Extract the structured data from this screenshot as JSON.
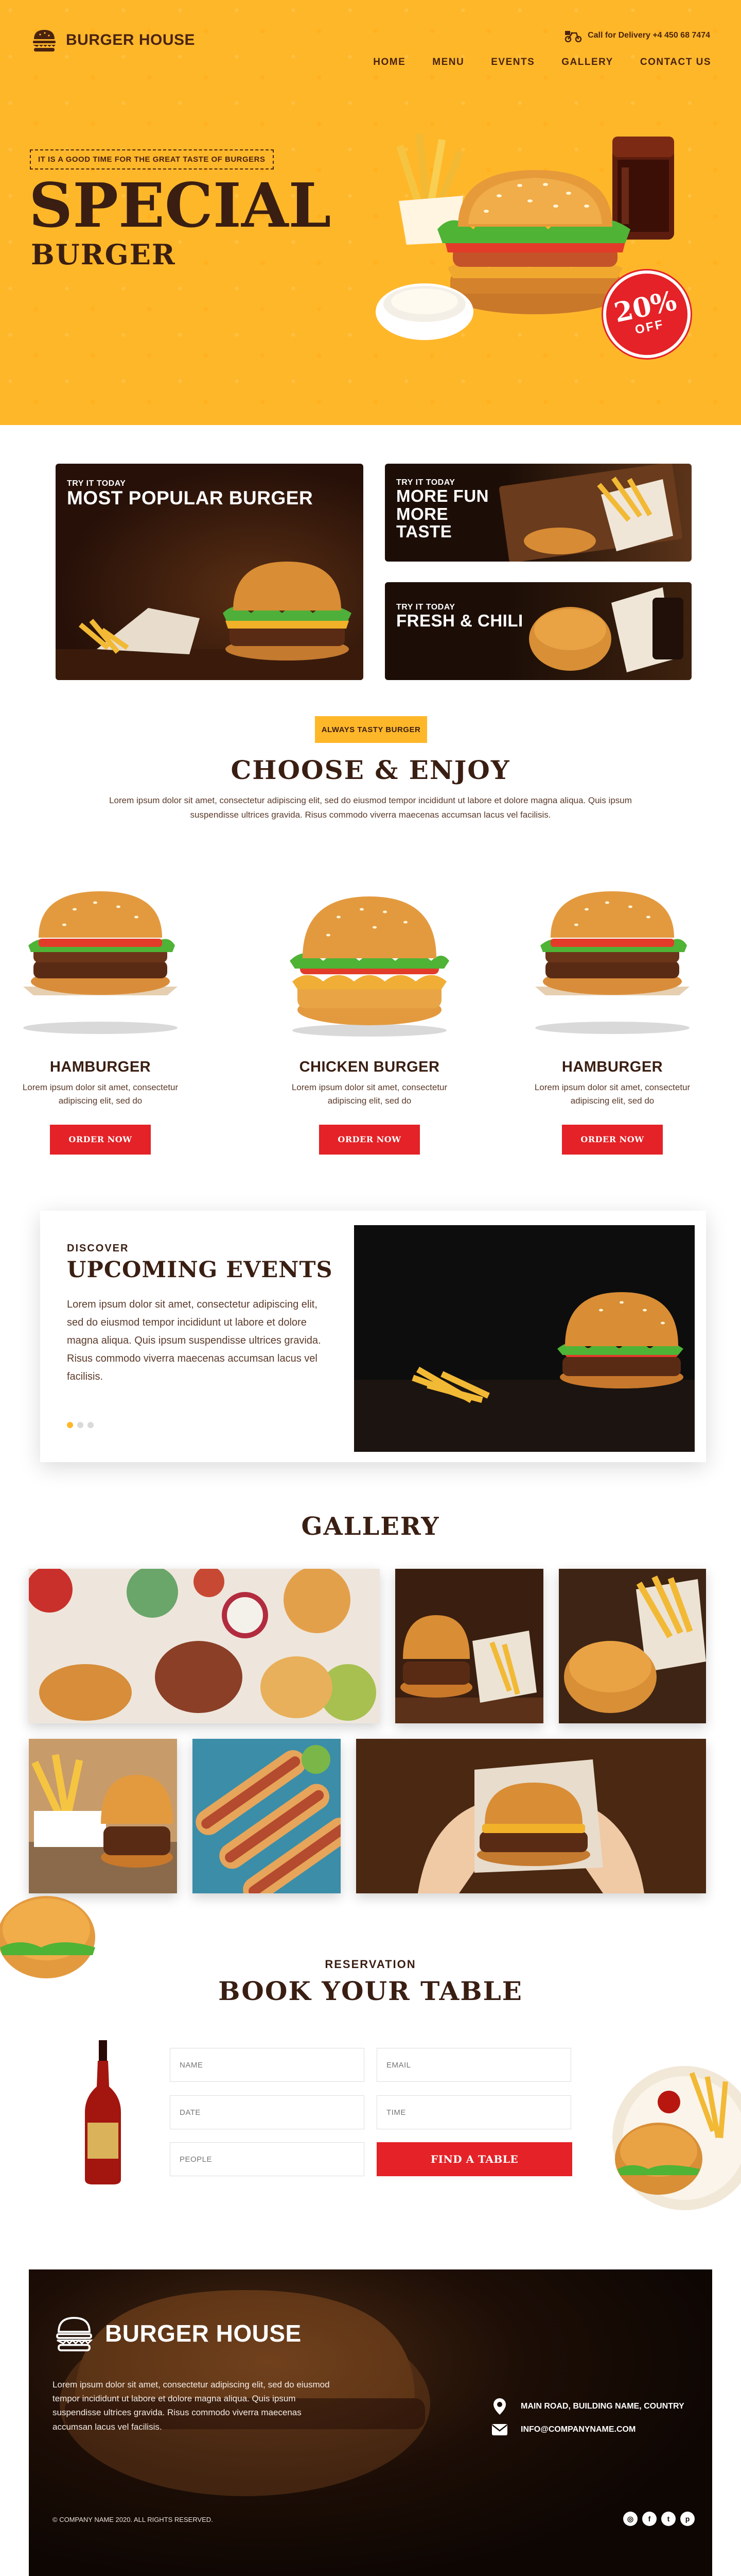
{
  "brand": {
    "name": "BURGER HOUSE"
  },
  "header": {
    "delivery": "Call for Delivery +4 450 68 7474",
    "nav": [
      "HOME",
      "MENU",
      "EVENTS",
      "GALLERY",
      "CONTACT US"
    ]
  },
  "hero": {
    "tagline": "IT IS A GOOD TIME FOR THE GREAT TASTE OF BURGERS",
    "title": "SPECIAL",
    "subtitle": "BURGER",
    "discount_pct": "20%",
    "discount_off": "OFF"
  },
  "promos": [
    {
      "small": "TRY IT TODAY",
      "big": "MOST POPULAR BURGER"
    },
    {
      "small": "TRY IT TODAY",
      "big": "MORE FUN MORE TASTE"
    },
    {
      "small": "TRY IT TODAY",
      "big": "FRESH & CHILI"
    }
  ],
  "choose": {
    "badge": "ALWAYS TASTY BURGER",
    "title": "CHOOSE & ENJOY",
    "desc": "Lorem ipsum dolor sit amet, consectetur adipiscing elit, sed do eiusmod tempor incididunt ut labore et dolore magna aliqua. Quis ipsum suspendisse ultrices gravida. Risus commodo viverra maecenas accumsan lacus vel facilisis."
  },
  "products": [
    {
      "name": "HAMBURGER",
      "desc": "Lorem ipsum dolor sit amet, consectetur adipiscing elit, sed do",
      "button": "ORDER NOW"
    },
    {
      "name": "CHICKEN BURGER",
      "desc": "Lorem ipsum dolor sit amet, consectetur adipiscing elit, sed do",
      "button": "ORDER NOW"
    },
    {
      "name": "HAMBURGER",
      "desc": "Lorem ipsum dolor sit amet, consectetur adipiscing elit, sed do",
      "button": "ORDER NOW"
    }
  ],
  "events": {
    "kicker": "DISCOVER",
    "title": "UPCOMING EVENTS",
    "text": "Lorem ipsum dolor sit amet, consectetur adipiscing elit, sed do eiusmod tempor incididunt ut labore et dolore magna aliqua. Quis ipsum suspendisse ultrices gravida. Risus commodo viverra maecenas accumsan lacus vel facilisis."
  },
  "gallery": {
    "title": "GALLERY"
  },
  "reservation": {
    "kicker": "RESERVATION",
    "title": "BOOK YOUR TABLE",
    "name_ph": "NAME",
    "email_ph": "EMAIL",
    "date_ph": "DATE",
    "time_ph": "TIME",
    "people_ph": "PEOPLE",
    "button": "FIND A TABLE"
  },
  "footer": {
    "name": "BURGER HOUSE",
    "desc": "Lorem ipsum dolor sit amet, consectetur adipiscing elit, sed do eiusmod tempor incididunt ut labore et dolore magna aliqua. Quis ipsum suspendisse ultrices gravida. Risus commodo viverra maecenas accumsan lacus vel facilisis.",
    "address": "MAIN ROAD, BUILDING NAME, COUNTRY",
    "email": "INFO@COMPANYNAME.COM",
    "copyright": "© COMPANY NAME 2020. ALL RIGHTS RESERVED.",
    "social": [
      "instagram-icon",
      "facebook-icon",
      "twitter-icon",
      "pinterest-icon"
    ]
  },
  "colors": {
    "accent": "#ffb72a",
    "red": "#e42227",
    "brown": "#3a1e12"
  }
}
